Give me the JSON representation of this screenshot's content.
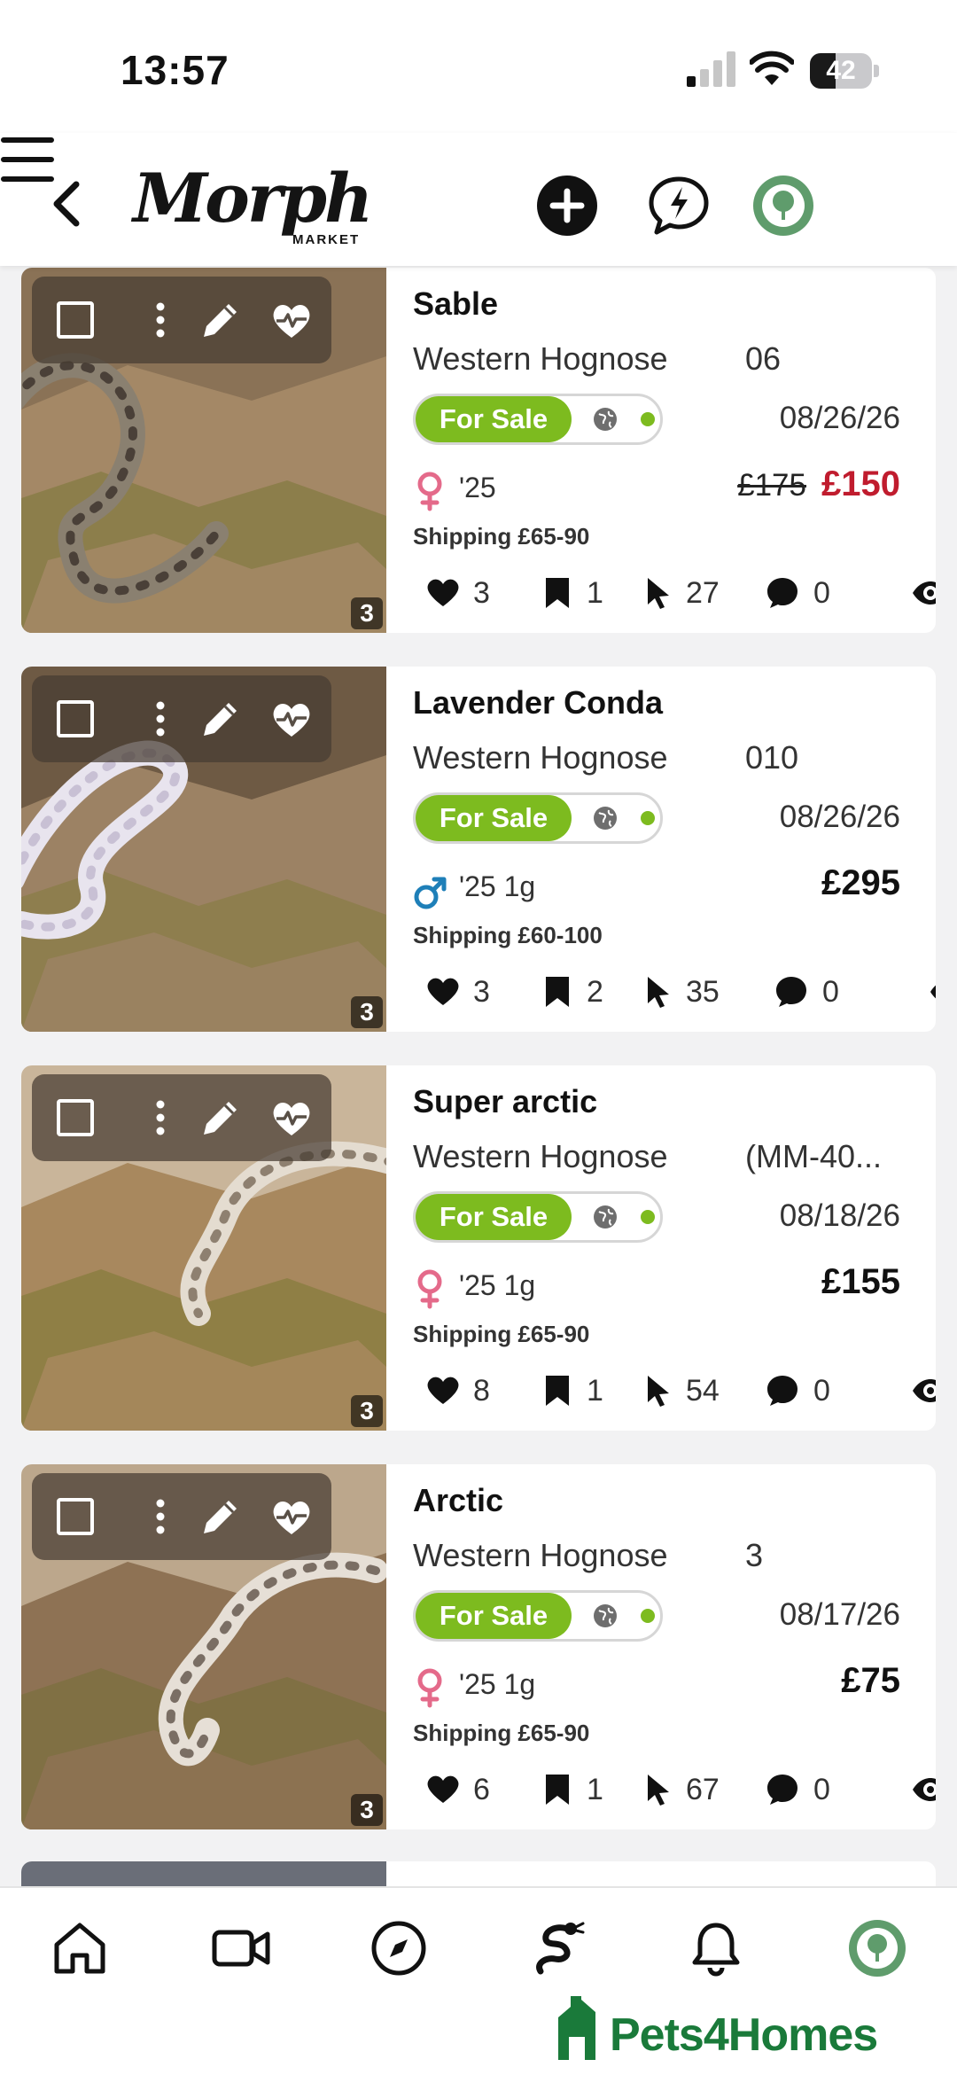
{
  "status_bar": {
    "time": "13:57",
    "battery": "42",
    "battery_level": 0.42
  },
  "header": {
    "logo_main": "Morph",
    "logo_sub": "MARKET"
  },
  "listings": [
    {
      "title": "Sable",
      "species": "Western Hognose",
      "code": "06",
      "status": "For Sale",
      "date": "08/26/26",
      "sex": "female",
      "age": "'25",
      "old_price": "£175",
      "price": "£150",
      "shipping": "Shipping £65-90",
      "likes": "3",
      "saves": "1",
      "clicks": "27",
      "comments": "0",
      "photo_count": "3"
    },
    {
      "title": "Lavender Conda",
      "species": "Western Hognose",
      "code": "010",
      "status": "For Sale",
      "date": "08/26/26",
      "sex": "male",
      "age": "'25 1g",
      "old_price": "",
      "price": "£295",
      "shipping": "Shipping £60-100",
      "likes": "3",
      "saves": "2",
      "clicks": "35",
      "comments": "0",
      "photo_count": "3"
    },
    {
      "title": "Super arctic",
      "species": "Western Hognose",
      "code": "(MM-40...",
      "status": "For Sale",
      "date": "08/18/26",
      "sex": "female",
      "age": "'25 1g",
      "old_price": "",
      "price": "£155",
      "shipping": "Shipping £65-90",
      "likes": "8",
      "saves": "1",
      "clicks": "54",
      "comments": "0",
      "photo_count": "3"
    },
    {
      "title": "Arctic",
      "species": "Western Hognose",
      "code": "3",
      "status": "For Sale",
      "date": "08/17/26",
      "sex": "female",
      "age": "'25 1g",
      "old_price": "",
      "price": "£75",
      "shipping": "Shipping £65-90",
      "likes": "6",
      "saves": "1",
      "clicks": "67",
      "comments": "0",
      "photo_count": "3"
    }
  ],
  "bottom_nav": {
    "items": [
      "home-icon",
      "video-icon",
      "compass-icon",
      "snake-icon",
      "bell-icon",
      "avatar-icon"
    ],
    "watermark": "Pets4Homes"
  },
  "colors": {
    "for_sale": "#7dbb1f",
    "sale_price": "#c01c2e",
    "female": "#e46a8a",
    "male": "#1e7fb8",
    "avatar_green": "#5f9c6c"
  }
}
